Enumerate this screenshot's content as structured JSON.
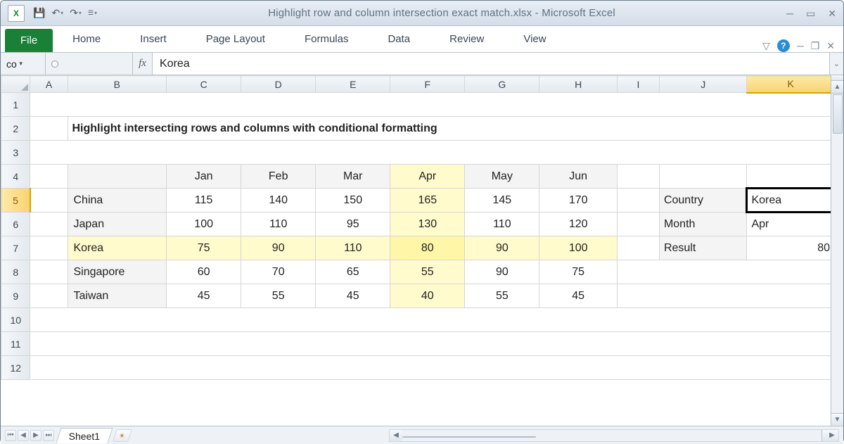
{
  "app": {
    "title": "Highlight row and column intersection exact match.xlsx - Microsoft Excel"
  },
  "qat": {
    "save": "💾",
    "undo": "↶",
    "redo": "↷",
    "more": "▾"
  },
  "ribbon": {
    "tabs": [
      "File",
      "Home",
      "Insert",
      "Page Layout",
      "Formulas",
      "Data",
      "Review",
      "View"
    ]
  },
  "namebox": "co",
  "formula": "Korea",
  "cols": [
    "A",
    "B",
    "C",
    "D",
    "E",
    "F",
    "G",
    "H",
    "I",
    "J",
    "K"
  ],
  "selectedCol": "K",
  "rows": [
    1,
    2,
    3,
    4,
    5,
    6,
    7,
    8,
    9,
    10,
    11,
    12
  ],
  "selectedRow": 5,
  "title_text": "Highlight intersecting rows and columns with conditional formatting",
  "chart_data": {
    "type": "table",
    "title": "Highlight intersecting rows and columns with conditional formatting",
    "months": [
      "Jan",
      "Feb",
      "Mar",
      "Apr",
      "May",
      "Jun"
    ],
    "countries": [
      "China",
      "Japan",
      "Korea",
      "Singapore",
      "Taiwan"
    ],
    "values": [
      [
        115,
        140,
        150,
        165,
        145,
        170
      ],
      [
        100,
        110,
        95,
        130,
        110,
        120
      ],
      [
        75,
        90,
        110,
        80,
        90,
        100
      ],
      [
        60,
        70,
        65,
        55,
        90,
        75
      ],
      [
        45,
        55,
        45,
        40,
        55,
        45
      ]
    ],
    "highlight_row": "Korea",
    "highlight_col": "Apr"
  },
  "lookup": {
    "labels": {
      "country": "Country",
      "month": "Month",
      "result": "Result"
    },
    "country": "Korea",
    "month": "Apr",
    "result": 80
  },
  "sheet": {
    "name": "Sheet1"
  }
}
